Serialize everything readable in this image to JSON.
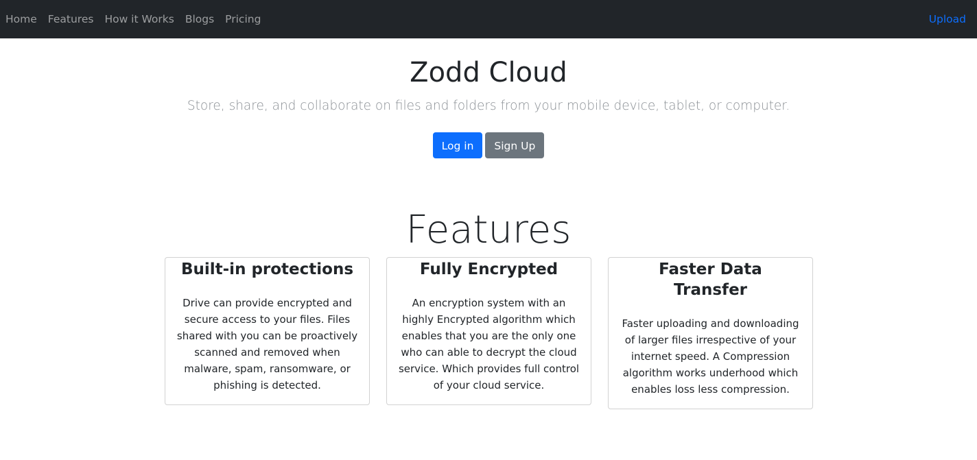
{
  "nav": {
    "links": [
      "Home",
      "Features",
      "How it Works",
      "Blogs",
      "Pricing"
    ],
    "upload": "Upload"
  },
  "hero": {
    "title": "Zodd Cloud",
    "lead": "Store, share, and collaborate on files and folders from your mobile device, tablet, or computer.",
    "login": "Log in",
    "signup": "Sign Up"
  },
  "features": {
    "heading": "Features",
    "cards": [
      {
        "title": "Built-in protections",
        "text": "Drive can provide encrypted and secure access to your files. Files shared with you can be proactively scanned and removed when malware, spam, ransomware, or phishing is detected."
      },
      {
        "title": "Fully Encrypted",
        "text": "An encryption system with an highly Encrypted algorithm which enables that you are the only one who can able to decrypt the cloud service. Which provides full control of your cloud service."
      },
      {
        "title": "Faster Data Transfer",
        "text": "Faster uploading and downloading of larger files irrespective of your internet speed. A Compression algorithm works underhood which enables loss less compression."
      }
    ]
  },
  "colors": {
    "navbar_bg": "#212529",
    "primary": "#0d6efd",
    "secondary": "#6c757d"
  }
}
